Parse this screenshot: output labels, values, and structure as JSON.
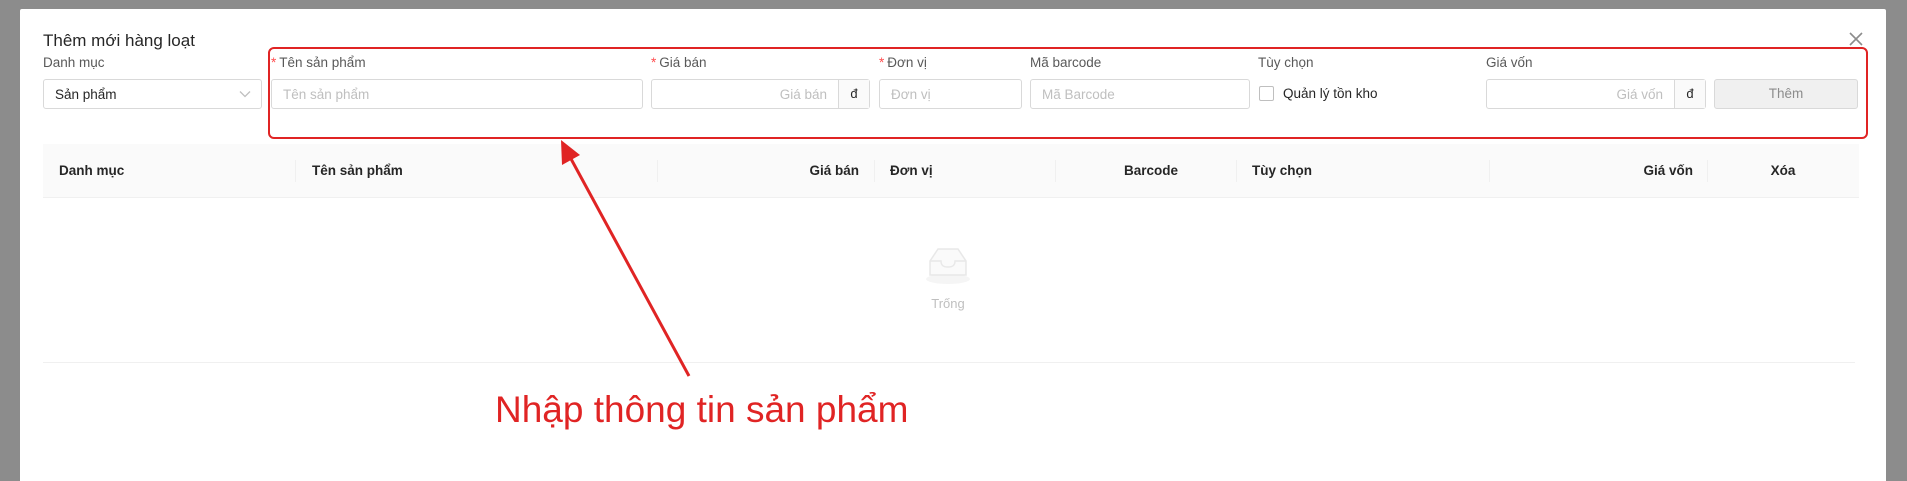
{
  "modal": {
    "title": "Thêm mới hàng loạt"
  },
  "form": {
    "category": {
      "label": "Danh mục",
      "value": "Sản phẩm"
    },
    "product_name": {
      "required": "*",
      "label": "Tên sản phẩm",
      "placeholder": "Tên sản phẩm"
    },
    "price": {
      "required": "*",
      "label": "Giá bán",
      "placeholder": "Giá bán",
      "addon": "đ"
    },
    "unit": {
      "required": "*",
      "label": "Đơn vị",
      "placeholder": "Đơn vị"
    },
    "barcode": {
      "label": "Mã barcode",
      "placeholder": "Mã Barcode"
    },
    "options": {
      "label": "Tùy chọn",
      "checkbox_label": "Quản lý tồn kho",
      "checked": false
    },
    "cost": {
      "label": "Giá vốn",
      "placeholder": "Giá vốn",
      "addon": "đ"
    },
    "add_button": "Thêm"
  },
  "table": {
    "columns": [
      "Danh mục",
      "Tên sản phẩm",
      "Giá bán",
      "Đơn vị",
      "Barcode",
      "Tùy chọn",
      "Giá vốn",
      "Xóa"
    ],
    "empty_text": "Trống"
  },
  "annotation": {
    "text": "Nhập thông tin sản phẩm",
    "color": "#e02424"
  }
}
